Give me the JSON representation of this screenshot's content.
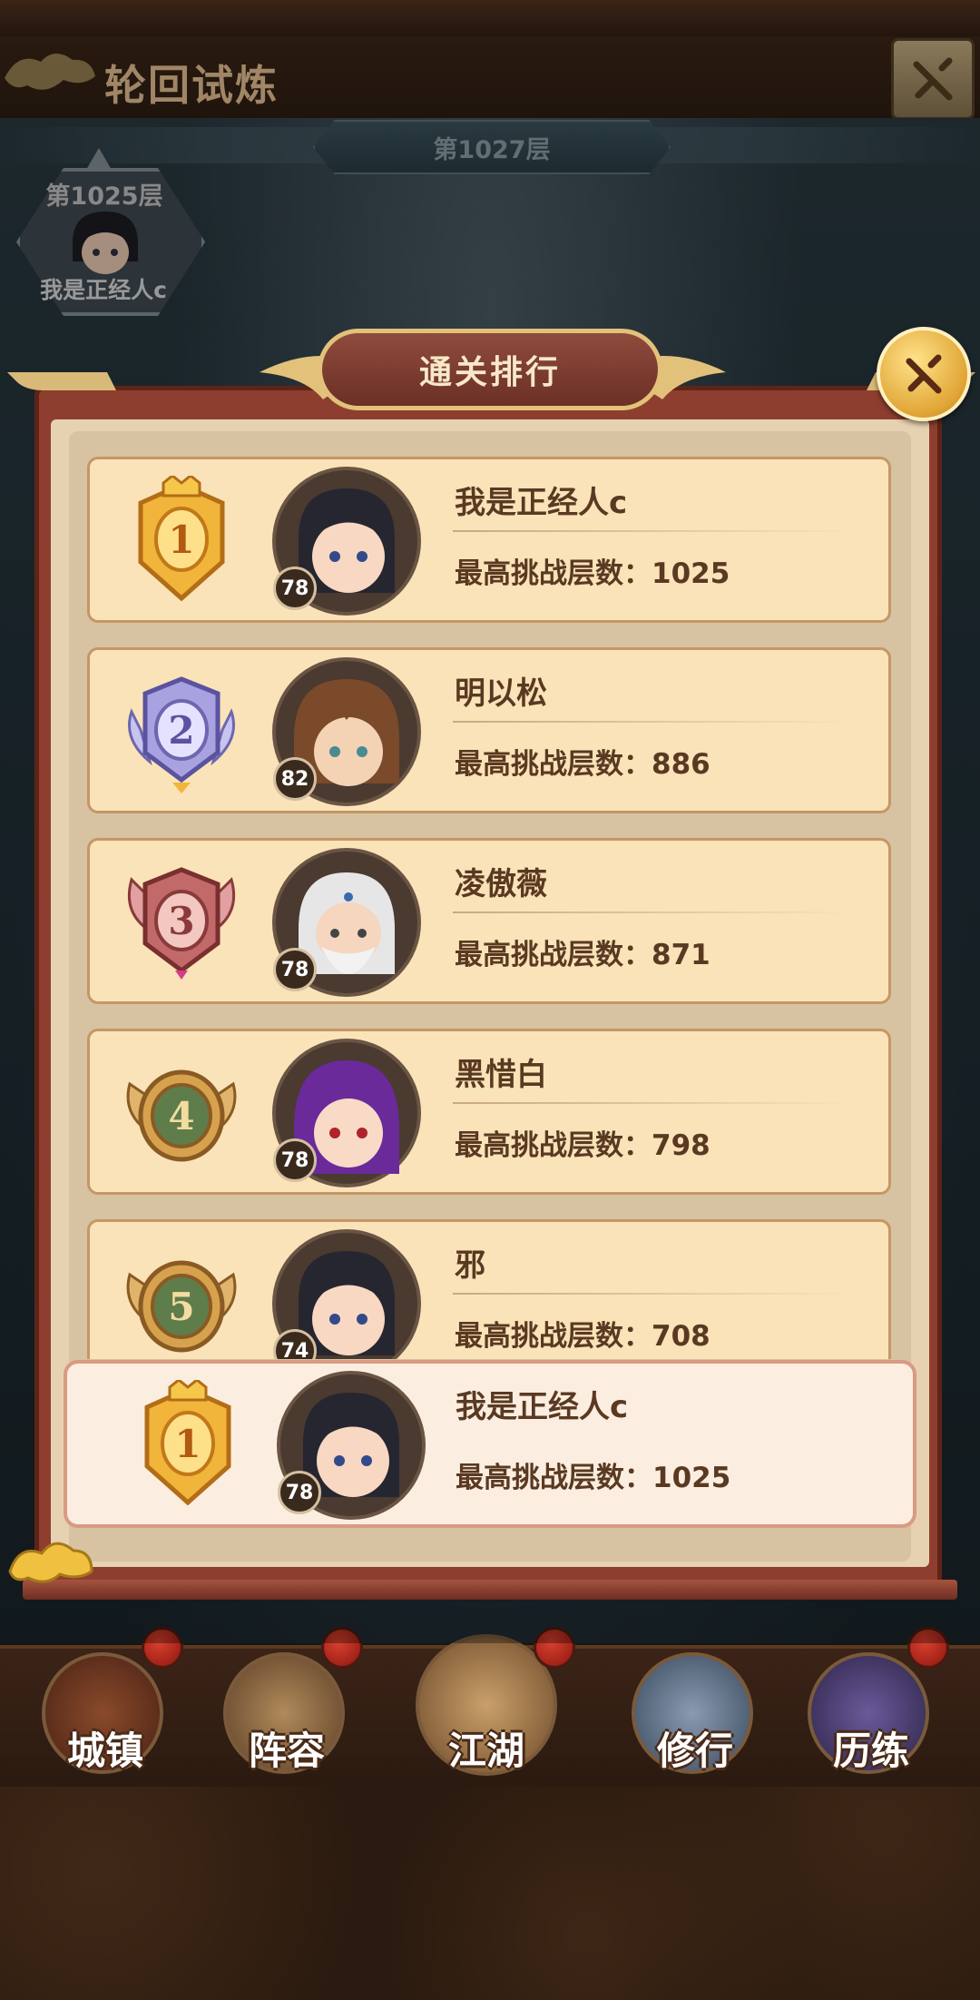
{
  "title_bar": {
    "title": "轮回试炼"
  },
  "floor_banner": {
    "label": "第1027层"
  },
  "current_node": {
    "floor": "第1025层",
    "player": "我是正经人c"
  },
  "modal": {
    "title": "通关排行",
    "rows": [
      {
        "rank": "1",
        "name": "我是正经人c",
        "level": "78",
        "score_label": "最高挑战层数：",
        "score": "1025"
      },
      {
        "rank": "2",
        "name": "明以松",
        "level": "82",
        "score_label": "最高挑战层数：",
        "score": "886"
      },
      {
        "rank": "3",
        "name": "凌傲薇",
        "level": "78",
        "score_label": "最高挑战层数：",
        "score": "871"
      },
      {
        "rank": "4",
        "name": "黑惜白",
        "level": "78",
        "score_label": "最高挑战层数：",
        "score": "798"
      },
      {
        "rank": "5",
        "name": "邪",
        "level": "74",
        "score_label": "最高挑战层数：",
        "score": "708"
      }
    ],
    "self_row": {
      "rank": "1",
      "name": "我是正经人c",
      "level": "78",
      "score_label": "最高挑战层数：",
      "score": "1025"
    }
  },
  "bottom_nav": [
    {
      "label": "城镇"
    },
    {
      "label": "阵容"
    },
    {
      "label": "江湖"
    },
    {
      "label": "修行"
    },
    {
      "label": "历练"
    }
  ],
  "colors": {
    "gold_badge": "#f0b53a",
    "silver_badge": "#a9a2e0",
    "bronze_badge": "#c26a6a",
    "plain_badge": "#5f7d4a",
    "row_bg": "#fae3b8",
    "text_brown": "#5a3922"
  }
}
